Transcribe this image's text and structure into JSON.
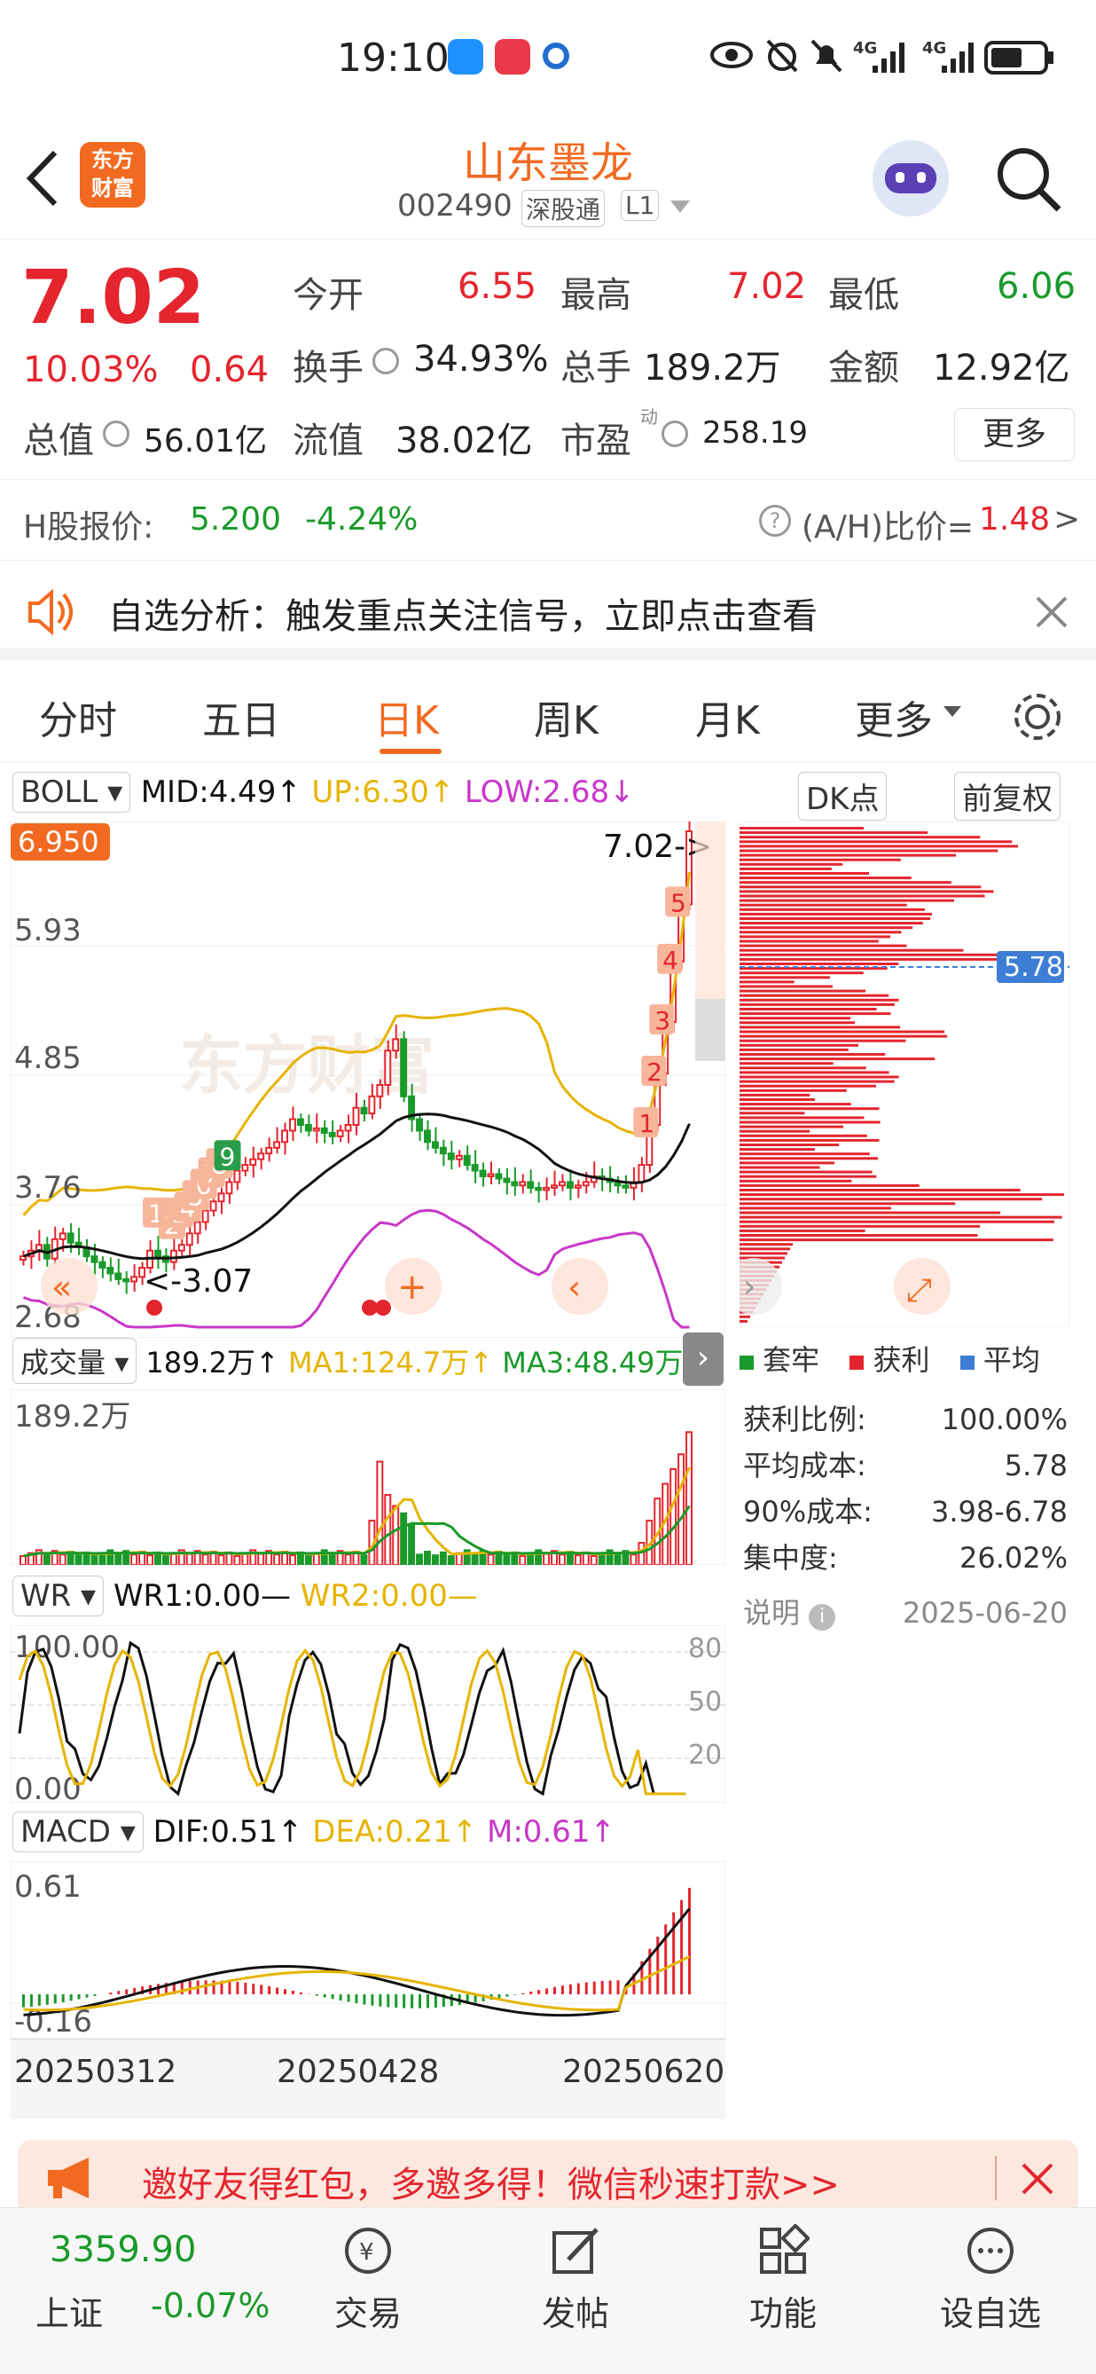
{
  "status": {
    "time": "19:10",
    "net1": "4G",
    "net2": "4G"
  },
  "header": {
    "title": "山东墨龙",
    "code": "002490",
    "exchange_tag": "深股通",
    "level": "L1",
    "logo_line1": "东方",
    "logo_line2": "财富"
  },
  "quote": {
    "price": "7.02",
    "change_pct": "10.03%",
    "change": "0.64",
    "open_label": "今开",
    "open": "6.55",
    "high_label": "最高",
    "high": "7.02",
    "low_label": "最低",
    "low": "6.06",
    "turnover_label": "换手",
    "turnover": "34.93%",
    "volume_label": "总手",
    "volume": "189.2万",
    "amount_label": "金额",
    "amount": "12.92亿",
    "mktcap_label": "总值",
    "mktcap": "56.01亿",
    "float_label": "流值",
    "float_cap": "38.02亿",
    "pe_label": "市盈",
    "pe_sup": "动",
    "pe": "258.19",
    "more": "更多"
  },
  "hshare": {
    "label": "H股报价:",
    "price": "5.200",
    "pct": "-4.24%",
    "ah_label": "(A/H)比价=",
    "ah": "1.48",
    "arrow": ">"
  },
  "banner": {
    "text": "自选分析：触发重点关注信号，立即点击查看"
  },
  "tabs": [
    "分时",
    "五日",
    "日K",
    "周K",
    "月K",
    "更多"
  ],
  "active_tab": "日K",
  "kline": {
    "indicator": "BOLL",
    "mid": "MID:4.49",
    "up": "UP:6.30",
    "low": "LOW:2.68",
    "dk": "DK点",
    "adjust": "前复权",
    "price_top": "6.950",
    "y1": "5.93",
    "y2": "4.85",
    "y3": "3.76",
    "y4": "2.68",
    "last_label": "7.02->",
    "min_label": "<-3.07",
    "cost_label": "5.78",
    "markers": [
      "1",
      "2",
      "3",
      "4",
      "5",
      "6",
      "7",
      "8",
      "9"
    ],
    "watermark": "东方财富",
    "closes": [
      3.3,
      3.35,
      3.4,
      3.28,
      3.45,
      3.5,
      3.42,
      3.38,
      3.3,
      3.25,
      3.2,
      3.15,
      3.1,
      3.08,
      3.12,
      3.2,
      3.35,
      3.3,
      3.25,
      3.35,
      3.4,
      3.5,
      3.6,
      3.7,
      3.78,
      3.85,
      3.95,
      4.05,
      4.1,
      4.15,
      4.2,
      4.25,
      4.3,
      4.4,
      4.5,
      4.45,
      4.4,
      4.42,
      4.38,
      4.35,
      4.4,
      4.45,
      4.6,
      4.55,
      4.7,
      4.8,
      5.1,
      5.2,
      4.7,
      4.5,
      4.4,
      4.3,
      4.25,
      4.2,
      4.15,
      4.18,
      4.1,
      4.05,
      4.0,
      4.02,
      3.98,
      3.95,
      3.92,
      3.95,
      3.9,
      3.88,
      3.9,
      3.92,
      3.95,
      3.9,
      3.92,
      3.95,
      4.0,
      3.98,
      3.95,
      3.92,
      3.9,
      3.95,
      4.1,
      4.45,
      4.9,
      5.35,
      5.88,
      6.38,
      7.02
    ]
  },
  "chips": {
    "legend": [
      "套牢",
      "获利",
      "平均"
    ],
    "profit_label": "获利比例:",
    "profit": "100.00%",
    "avg_label": "平均成本:",
    "avg": "5.78",
    "c90_label": "90%成本:",
    "c90": "3.98-6.78",
    "conc_label": "集中度:",
    "conc": "26.02%",
    "note": "说明",
    "date": "2025-06-20"
  },
  "volume": {
    "label": "成交量",
    "value": "189.2万",
    "ma1": "MA1:124.7万",
    "ma3": "MA3:48.49万",
    "top": "189.2万"
  },
  "wr": {
    "label": "WR",
    "wr1": "WR1:0.00",
    "wr2": "WR2:0.00",
    "top": "100.00",
    "bottom": "0.00",
    "r80": "80",
    "r50": "50",
    "r20": "20"
  },
  "macd": {
    "label": "MACD",
    "dif": "DIF:0.51",
    "dea": "DEA:0.21",
    "m": "M:0.61",
    "top": "0.61",
    "bottom": "-0.16",
    "dates": [
      "20250312",
      "20250428",
      "20250620"
    ]
  },
  "invite": {
    "text": "邀好友得红包，多邀多得！微信秒速打款>>"
  },
  "bottom": {
    "index_value": "3359.90",
    "index_name": "上证",
    "index_pct": "-0.07%",
    "items": [
      "交易",
      "发帖",
      "功能",
      "设自选"
    ]
  },
  "colors": {
    "up": "#e4252e",
    "down": "#1a9a2a",
    "accent": "#f26a21",
    "mid": "#111111",
    "upper": "#e6b400",
    "lower": "#c837c8"
  }
}
